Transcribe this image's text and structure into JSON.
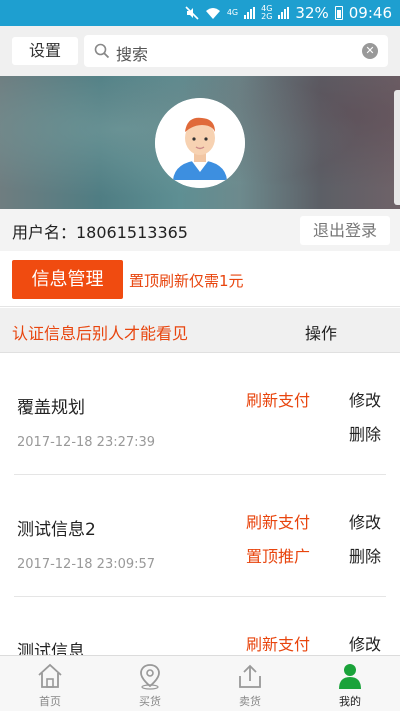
{
  "status_bar": {
    "network_a": "4G",
    "network_b": "4G",
    "network_b_sub": "2G",
    "battery": "32%",
    "time": "09:46"
  },
  "header": {
    "settings_label": "设置",
    "search_placeholder": "搜索"
  },
  "user": {
    "username_label": "用户名：18061513365",
    "logout_label": "退出登录"
  },
  "info": {
    "manage_label": "信息管理",
    "promo_text": "置顶刷新仅需1元"
  },
  "list_header": {
    "hint": "认证信息后别人才能看见",
    "operations_label": "操作"
  },
  "items": [
    {
      "title": "覆盖规划",
      "date": "2017-12-18 23:27:39",
      "action_1": "刷新支付",
      "action_2": "",
      "edit": "修改",
      "delete": "删除"
    },
    {
      "title": "测试信息2",
      "date": "2017-12-18 23:09:57",
      "action_1": "刷新支付",
      "action_2": "置顶推广",
      "edit": "修改",
      "delete": "删除"
    },
    {
      "title": "测试信息",
      "date": "",
      "action_1": "刷新支付",
      "action_2": "",
      "edit": "修改",
      "delete": ""
    }
  ],
  "bottom_nav": {
    "home": "首页",
    "buy": "买货",
    "sell": "卖货",
    "mine": "我的"
  },
  "colors": {
    "status_bar": "#1e9fd0",
    "accent_orange": "#f04b10",
    "active_green": "#1aa33a"
  }
}
